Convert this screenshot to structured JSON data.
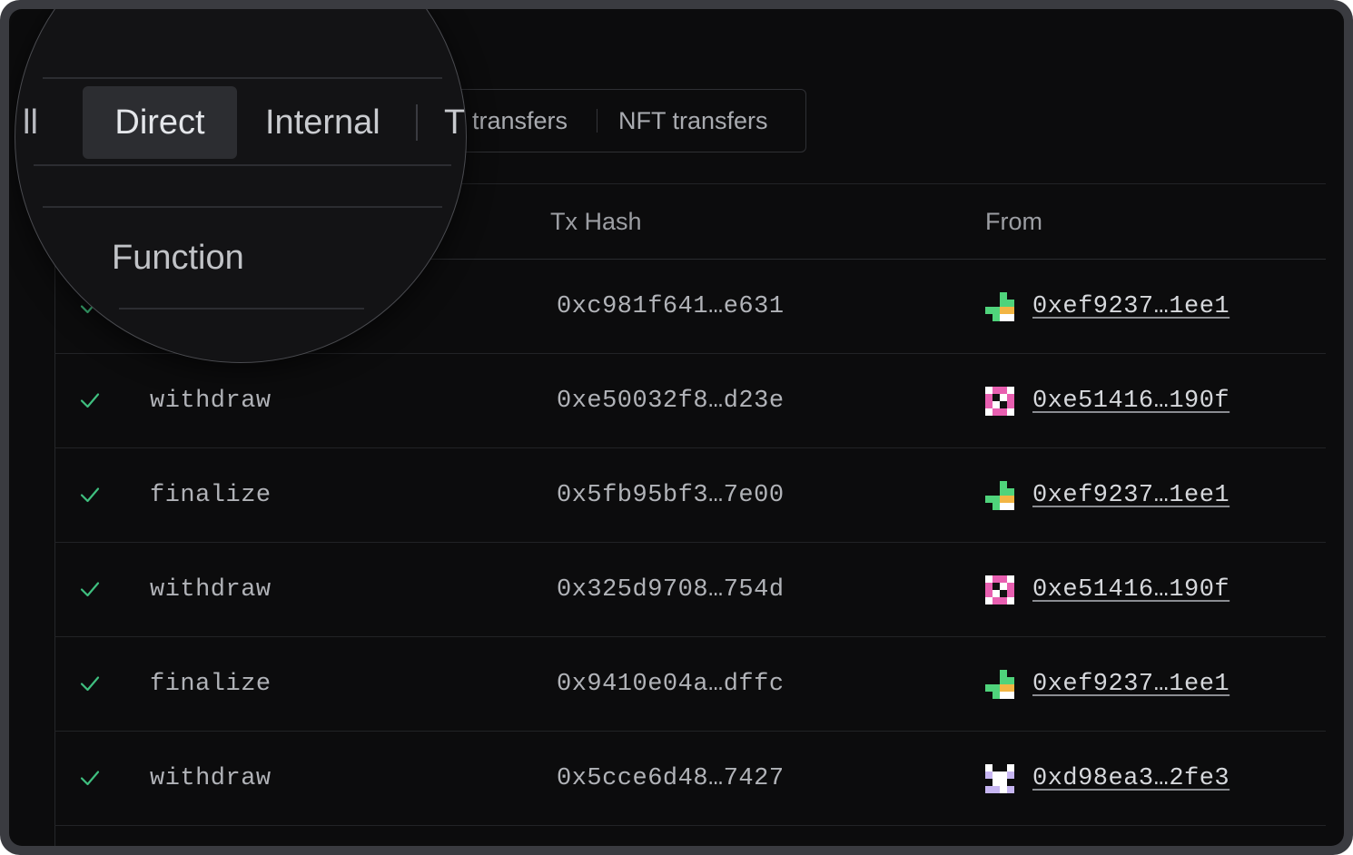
{
  "tabs": {
    "items": [
      "All",
      "Direct",
      "Internal",
      "Token transfers",
      "NFT transfers"
    ],
    "visible_background": [
      "transfers",
      "NFT transfers"
    ],
    "selected": "Direct"
  },
  "magnifier": {
    "tab_all_fragment": "ll",
    "tab_direct": "Direct",
    "tab_internal": "Internal",
    "tab_token_fragment": "T",
    "column_function": "Function"
  },
  "table": {
    "headers": {
      "tx_hash": "Tx Hash",
      "from": "From"
    },
    "rows": [
      {
        "function": "",
        "tx_hash": "0xc981f641…e631",
        "from": "0xef9237…1ee1",
        "blockie": "green"
      },
      {
        "function": "withdraw",
        "tx_hash": "0xe50032f8…d23e",
        "from": "0xe51416…190f",
        "blockie": "pink"
      },
      {
        "function": "finalize",
        "tx_hash": "0x5fb95bf3…7e00",
        "from": "0xef9237…1ee1",
        "blockie": "green"
      },
      {
        "function": "withdraw",
        "tx_hash": "0x325d9708…754d",
        "from": "0xe51416…190f",
        "blockie": "pink"
      },
      {
        "function": "finalize",
        "tx_hash": "0x9410e04a…dffc",
        "from": "0xef9237…1ee1",
        "blockie": "green"
      },
      {
        "function": "withdraw",
        "tx_hash": "0x5cce6d48…7427",
        "from": "0xd98ea3…2fe3",
        "blockie": "lavender"
      }
    ]
  },
  "colors": {
    "background": "#0c0c0d",
    "success_check": "#3fbf7f",
    "blockie_green": "#4fd37b",
    "blockie_orange": "#f2b544",
    "blockie_pink": "#e85fb0",
    "blockie_lavender": "#c7b6f2"
  },
  "icons": {
    "status": "check-icon"
  }
}
